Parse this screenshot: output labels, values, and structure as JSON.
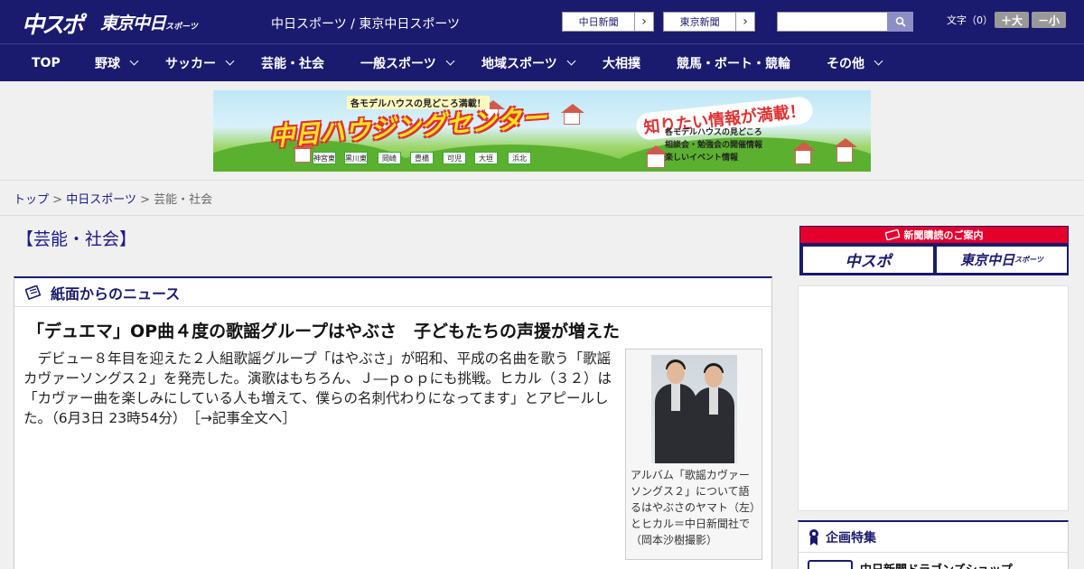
{
  "header": {
    "logo_chuspo": "中スポ",
    "logo_tokyo": "東京中日",
    "logo_tokyo_small": "スポーツ",
    "site_names": "中日スポーツ / 東京中日スポーツ",
    "paper_links": [
      "中日新聞",
      "東京新聞"
    ],
    "search_placeholder": "",
    "font_size_label": "文字（0）",
    "font_bigger": "＋大",
    "font_smaller": "－小"
  },
  "nav": {
    "items": [
      {
        "label": "TOP",
        "dropdown": false
      },
      {
        "label": "野球",
        "dropdown": true
      },
      {
        "label": "サッカー",
        "dropdown": true
      },
      {
        "label": "芸能・社会",
        "dropdown": false
      },
      {
        "label": "一般スポーツ",
        "dropdown": true
      },
      {
        "label": "地域スポーツ",
        "dropdown": true
      },
      {
        "label": "大相撲",
        "dropdown": false
      },
      {
        "label": "競馬・ボート・競輪",
        "dropdown": false
      },
      {
        "label": "その他",
        "dropdown": true
      }
    ]
  },
  "banner": {
    "small": "各モデルハウスの見どころ満載！",
    "title": "中日ハウジングセンター",
    "catch": "知りたい情報が満載！",
    "list": [
      "各モデルハウスの見どころ",
      "相談会・勉強会の開催情報",
      "楽しいイベント情報"
    ],
    "locations": [
      "神宮東",
      "黒川東",
      "岡崎",
      "豊橋",
      "可児",
      "大垣",
      "浜北"
    ]
  },
  "breadcrumb": {
    "items": [
      "トップ",
      "中日スポーツ",
      "芸能・社会"
    ],
    "sep": ">"
  },
  "section_title": "【芸能・社会】",
  "article": {
    "box_label": "紙面からのニュース",
    "headline": "「デュエマ」OP曲４度の歌謡グループはやぶさ　子どもたちの声援が増えた",
    "body": "デビュー８年目を迎えた２人組歌謡グループ「はやぶさ」が昭和、平成の名曲を歌う「歌謡カヴァーソングス２」を発売した。演歌はもちろん、Ｊ―ｐｏｐにも挑戦。ヒカル（３２）は「カヴァー曲を楽しみにしている人も増えて、僕らの名刺代わりになってます」とアピールした。",
    "timestamp": "（6月3日 23時54分）",
    "more": "［→記事全文へ］",
    "caption": "アルバム「歌謡カヴァーソングス２」について語るはやぶさのヤマト（左）とヒカル＝中日新聞社で（岡本沙樹撮影）"
  },
  "sidebar": {
    "subscribe_title": "新聞購読のご案内",
    "subscribe_buttons": [
      "中スポ",
      "東京中日"
    ],
    "subscribe_small": "スポーツ",
    "feature_title": "企画特集",
    "feature_item": "中日新聞ドラゴンズショップ"
  },
  "colors": {
    "navy": "#1a1a6e",
    "red": "#e4002b"
  }
}
